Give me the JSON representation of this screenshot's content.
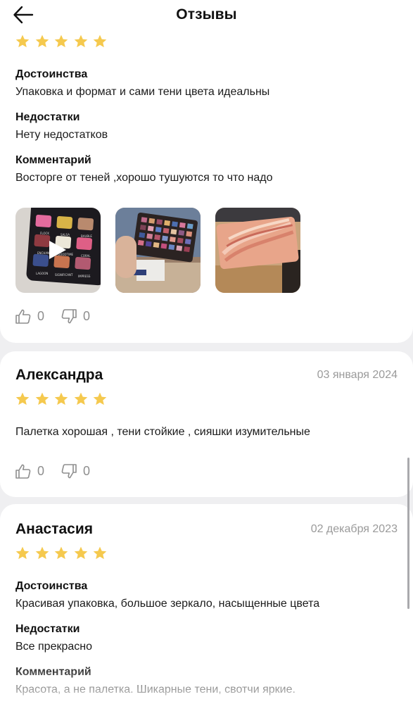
{
  "header": {
    "title": "Отзывы",
    "back_icon": "arrow-left-icon"
  },
  "colors": {
    "star": "#f5c94e",
    "muted": "#9a9a9a",
    "background": "#efeff1"
  },
  "reviews": [
    {
      "rating": 5,
      "sections": [
        {
          "label": "Достоинства",
          "text": "Упаковка и формат и сами тени цвета идеальны"
        },
        {
          "label": "Недостатки",
          "text": "Нету недостатков"
        },
        {
          "label": "Комментарий",
          "text": "Восторге от теней ,хорошо тушуются то что надо"
        }
      ],
      "photos": [
        {
          "type": "video",
          "labels": [
            "FLOCK",
            "SALSA",
            "BAUBLE",
            "ENCHANT",
            "GOODTIME",
            "CORAL",
            "LAGOON",
            "SIGNIFICANT",
            "IMPRESS"
          ]
        },
        {
          "type": "photo"
        },
        {
          "type": "photo"
        }
      ],
      "likes": "0",
      "dislikes": "0"
    },
    {
      "author": "Александра",
      "date": "03 января 2024",
      "rating": 5,
      "comment": "Палетка хорошая , тени стойкие , сияшки изумительные",
      "likes": "0",
      "dislikes": "0"
    },
    {
      "author": "Анастасия",
      "date": "02 декабря 2023",
      "rating": 5,
      "sections": [
        {
          "label": "Достоинства",
          "text": "Красивая упаковка, большое зеркало, насыщенные цвета"
        },
        {
          "label": "Недостатки",
          "text": "Все прекрасно"
        },
        {
          "label": "Комментарий",
          "text": "Красота, а не палетка. Шикарные тени, свотчи яркие."
        }
      ]
    }
  ]
}
